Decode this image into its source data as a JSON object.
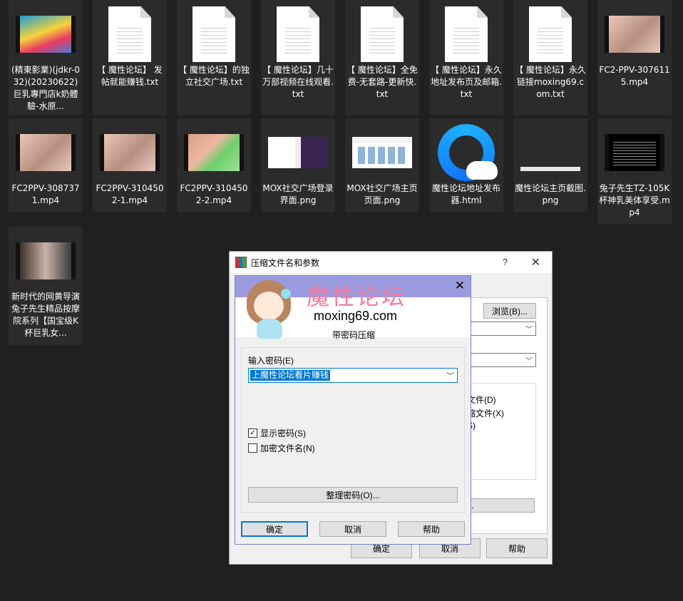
{
  "files": [
    {
      "name": "(精東影業)(jdkr-032)(20230622)巨乳專門店k奶體驗-水原...",
      "type": "video",
      "thumb": "thumb1"
    },
    {
      "name": "【 魔性论坛】 发帖就能赚钱.txt",
      "type": "text"
    },
    {
      "name": "【 魔性论坛】的独立社交广场.txt",
      "type": "text"
    },
    {
      "name": "【 魔性论坛】几十万部视频在线观看.txt",
      "type": "text"
    },
    {
      "name": "【 魔性论坛】全免费-无套路-更新快.txt",
      "type": "text"
    },
    {
      "name": "【 魔性论坛】永久地址发布页及邮箱.txt",
      "type": "text"
    },
    {
      "name": "【 魔性论坛】永久链接moxing69.com.txt",
      "type": "text"
    },
    {
      "name": "FC2-PPV-3076115.mp4",
      "type": "video",
      "thumb": "skin"
    },
    {
      "name": "FC2PPV-3087371.mp4",
      "type": "video",
      "thumb": "skin"
    },
    {
      "name": "FC2PPV-3104502-1.mp4",
      "type": "video",
      "thumb": "skin"
    },
    {
      "name": "FC2PPV-3104502-2.mp4",
      "type": "video",
      "thumb": "green"
    },
    {
      "name": "MOX社交广场登录界面.png",
      "type": "image",
      "thumb": "a"
    },
    {
      "name": "MOX社交广场主页页面.png",
      "type": "image",
      "thumb": "b"
    },
    {
      "name": "魔性论坛地址发布器.html",
      "type": "html"
    },
    {
      "name": "魔性论坛主页截图.png",
      "type": "image",
      "thumb": "c"
    },
    {
      "name": "兔子先生TZ-105K杯神乳美体享受.mp4",
      "type": "video",
      "thumb": "poster"
    },
    {
      "name": "新时代的网黄导演兔子先生精品按摩院系列【国宝级K杯巨乳女...",
      "type": "video",
      "thumb": "webcam"
    }
  ],
  "back_dialog": {
    "title": "压缩文件名和参数",
    "help_glyph": "?",
    "close_glyph": "✕",
    "browse_label": "浏览(B)...",
    "opt1": "文件(D)",
    "opt2": "缩文件(X)",
    "opt3": "S)",
    "more_label": "...",
    "ok_label": "确定",
    "cancel_label": "取消",
    "help_label": "帮助"
  },
  "password_dialog": {
    "close_glyph": "✕",
    "watermark_cn": "魔性论坛",
    "watermark_url": "moxing69.com",
    "subtitle": "带密码压缩",
    "enter_label": "输入密码(E)",
    "password_value": "上魔性论坛看片赚钱",
    "show_password_label": "显示密码(S)",
    "show_password_checked": "✓",
    "encrypt_names_label": "加密文件名(N)",
    "organize_label": "整理密码(O)...",
    "ok_label": "确定",
    "cancel_label": "取消",
    "help_label": "帮助"
  },
  "colors": {
    "desktop_bg": "#202020",
    "tile_bg": "#2b2b2b",
    "dialog_title_accent": "#9b9be0",
    "selection": "#0078d7",
    "watermark_pink": "#f37ba0"
  }
}
